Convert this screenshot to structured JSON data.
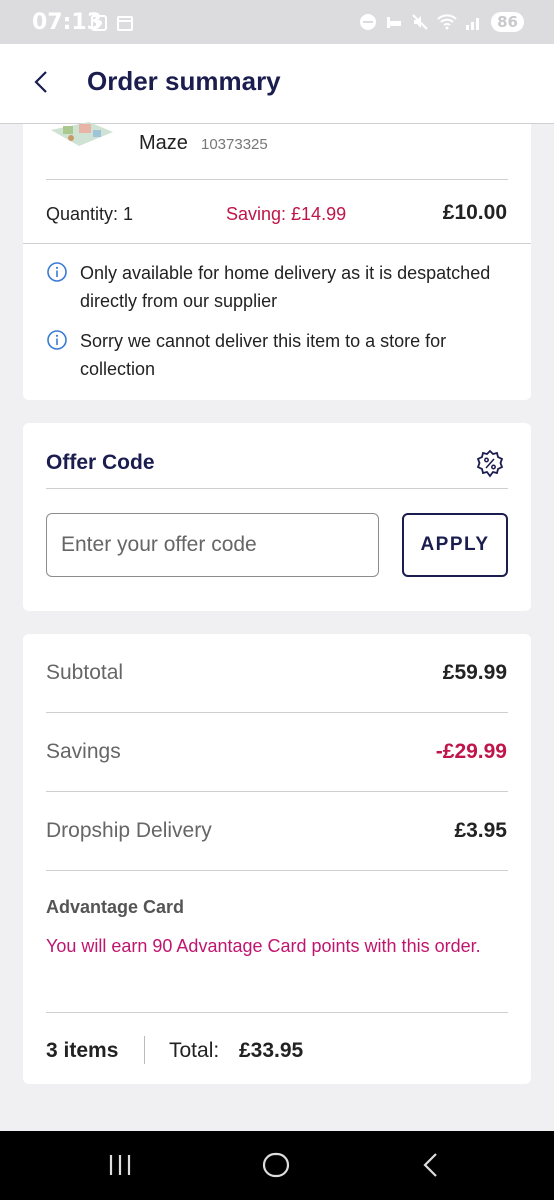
{
  "status_bar": {
    "time": "07:13",
    "battery": "86",
    "icons": [
      "screenshot-icon",
      "calendar-icon",
      "dnd-icon",
      "sleep-icon",
      "mute-icon",
      "wifi-icon",
      "signal-icon"
    ]
  },
  "header": {
    "title": "Order summary",
    "back_icon": "chevron-left-icon"
  },
  "product": {
    "name": "Maze",
    "sku": "10373325",
    "quantity": "Quantity: 1",
    "saving": "Saving: £14.99",
    "price": "£10.00",
    "notes": [
      "Only available for home delivery as it is despatched directly from our supplier",
      "Sorry we cannot deliver this item to a store for collection"
    ]
  },
  "offer": {
    "title": "Offer Code",
    "placeholder": "Enter your offer code",
    "value": "",
    "apply_label": "APPLY"
  },
  "summary": {
    "subtotal_label": "Subtotal",
    "subtotal_value": "£59.99",
    "savings_label": "Savings",
    "savings_value": "-£29.99",
    "delivery_label": "Dropship Delivery",
    "delivery_value": "£3.95",
    "advantage_label": "Advantage Card",
    "advantage_text": "You will earn 90 Advantage Card points with this order.",
    "items_count": "3 items",
    "total_label": "Total:",
    "total_value": "£33.95"
  },
  "colors": {
    "navy": "#1b1d4f",
    "saving_red": "#c0154a",
    "advantage_pink": "#c0156e",
    "info_blue": "#3a7bd5"
  }
}
